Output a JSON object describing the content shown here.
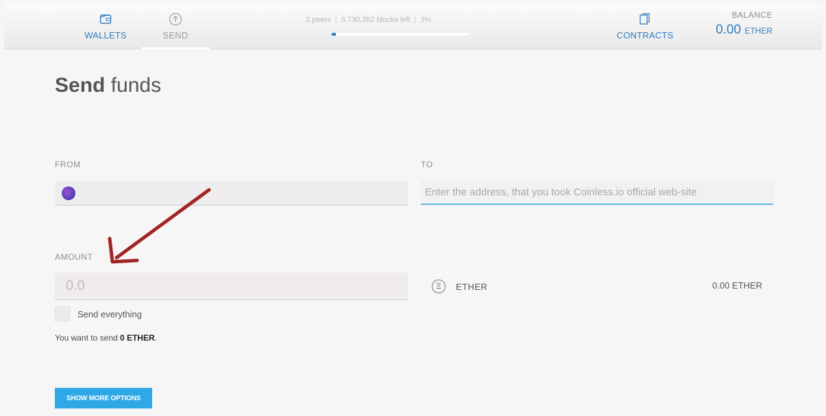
{
  "header": {
    "tabs": [
      {
        "label": "WALLETS",
        "icon": "wallet-icon"
      },
      {
        "label": "SEND",
        "icon": "send-icon"
      },
      {
        "label": "CONTRACTS",
        "icon": "contracts-icon"
      }
    ],
    "sync": {
      "peers": "2 peers",
      "blocks_left": "3,730,352 blocks left",
      "percent": "3%",
      "progress": 0.03
    },
    "balance": {
      "label": "BALANCE",
      "value": "0.00",
      "unit": "ETHER"
    }
  },
  "main": {
    "title_bold": "Send",
    "title_rest": " funds",
    "from": {
      "label": "FROM"
    },
    "to": {
      "label": "TO",
      "value": "",
      "placeholder": "Enter the address, that you took Coinless.io official web-site"
    },
    "amount": {
      "label": "AMOUNT",
      "value": "",
      "placeholder": "0.0"
    },
    "currency": {
      "label": "ETHER",
      "icon": "ether-icon"
    },
    "available_balance": "0.00 ETHER",
    "send_everything": "Send everything",
    "summary_prefix": "You want to send ",
    "summary_amount": "0 ETHER",
    "summary_suffix": ".",
    "more_options_label": "SHOW MORE OPTIONS"
  },
  "colors": {
    "accent": "#2f7cbf",
    "button": "#2fa8e6",
    "input_focus": "#55b8e0",
    "annotation_arrow": "#a32424"
  }
}
